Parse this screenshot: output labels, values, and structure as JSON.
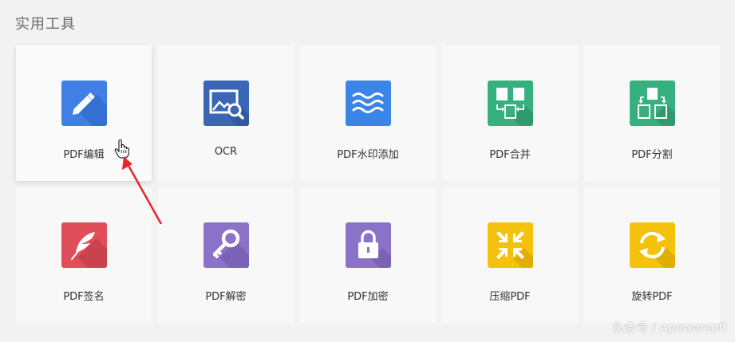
{
  "section": {
    "title": "实用工具"
  },
  "tools": [
    {
      "label": "PDF编辑",
      "icon": "pencil-edit-icon",
      "color": "#3f7fe6"
    },
    {
      "label": "OCR",
      "icon": "image-search-icon",
      "color": "#3a66b5"
    },
    {
      "label": "PDF水印添加",
      "icon": "waves-watermark-icon",
      "color": "#3b84e8"
    },
    {
      "label": "PDF合并",
      "icon": "merge-pages-icon",
      "color": "#35b07e"
    },
    {
      "label": "PDF分割",
      "icon": "split-pages-icon",
      "color": "#35b07e"
    },
    {
      "label": "PDF签名",
      "icon": "feather-sign-icon",
      "color": "#e04e5a"
    },
    {
      "label": "PDF解密",
      "icon": "key-icon",
      "color": "#8a72c9"
    },
    {
      "label": "PDF加密",
      "icon": "lock-icon",
      "color": "#8a72c9"
    },
    {
      "label": "压缩PDF",
      "icon": "compress-arrows-icon",
      "color": "#f4c20d"
    },
    {
      "label": "旋转PDF",
      "icon": "rotate-arrows-icon",
      "color": "#f4c20d"
    }
  ],
  "watermark": "头条号 / Apowersoft",
  "annotation": {
    "arrow_color": "#e8262b"
  }
}
